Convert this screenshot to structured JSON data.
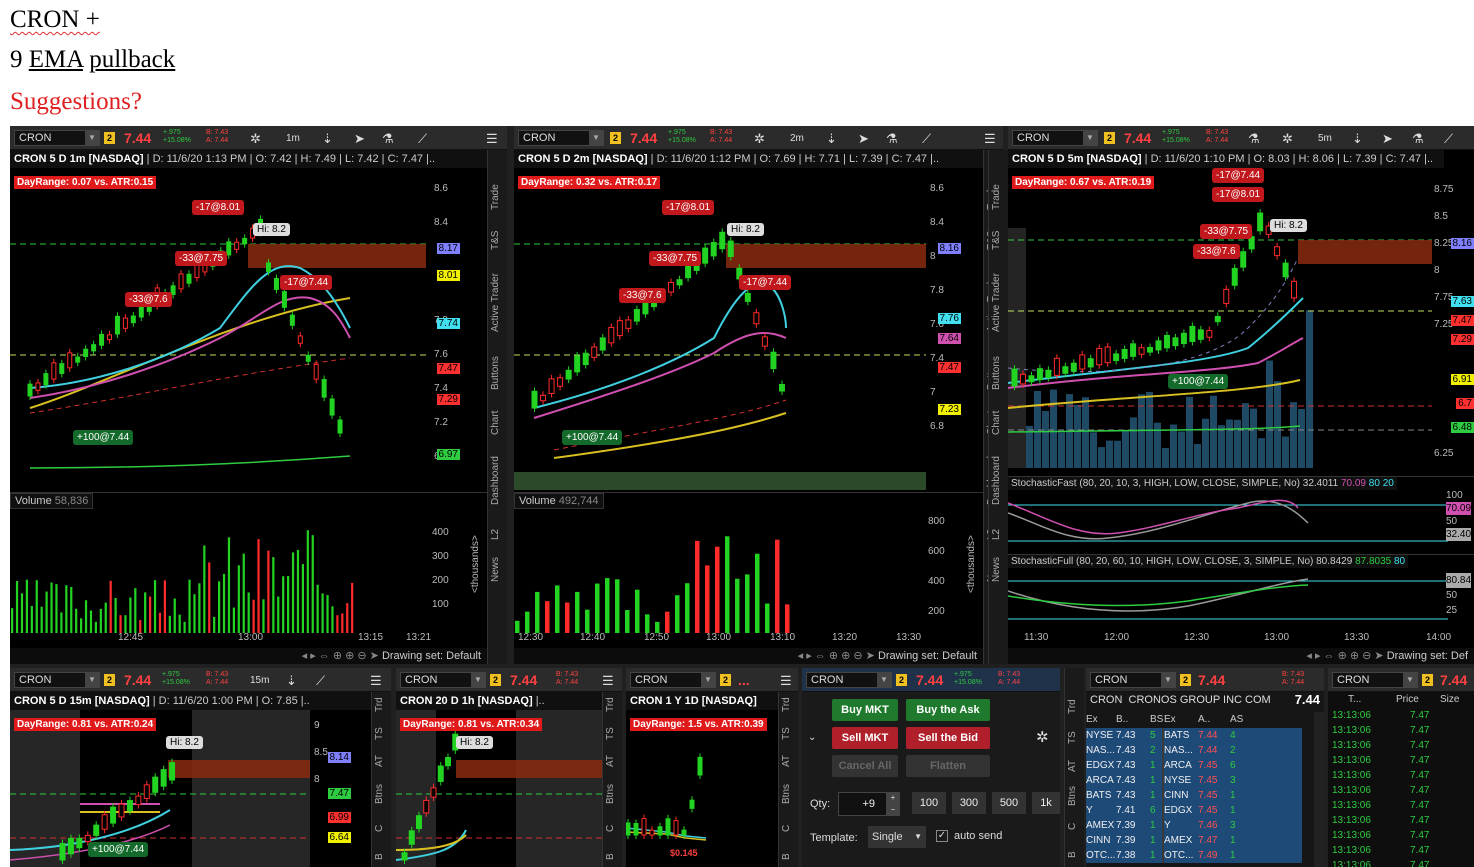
{
  "doc": {
    "line1": "CRON +",
    "line2_num": "9",
    "line2_ema": "EMA",
    "line2_rest": "pullback",
    "line3": "Suggestions?"
  },
  "colors": {
    "up": "#22d322",
    "down": "#ff2a2a",
    "ema9": "#3fd0e0",
    "ema_pink": "#d050b0",
    "ema_yellow": "#d8c020",
    "bg": "#000000",
    "accent_red": "#e01a1a"
  },
  "panels": {
    "p1": {
      "symbol": "CRON",
      "badge": "2",
      "last": "7.44",
      "chg1": "+.975",
      "chg2": "+15.08%",
      "bid": "B: 7.43",
      "ask": "A: 7.44",
      "tf": "1m",
      "header": {
        "title": "CRON 5 D 1m [NASDAQ]",
        "rest": "D: 11/6/20 1:13 PM | O: 7.42 | H: 7.49 | L: 7.42 | C: 7.47 |.."
      },
      "dayrange": "DayRange: 0.07 vs. ATR:0.15",
      "tags": [
        "-17@8.01",
        "-33@7.75",
        "-17@7.44",
        "-33@7.6"
      ],
      "buytag": "+100@7.44",
      "hi": "Hi: 8.2",
      "yaxis": [
        "8.6",
        "8.4",
        "7.8",
        "7.6",
        "7.4",
        "7.2",
        "6.8"
      ],
      "plabels": [
        {
          "t": "8.17",
          "c": "#8080ff"
        },
        {
          "t": "8.01",
          "c": "#f0f000"
        },
        {
          "t": "7.74",
          "c": "#40e0f0"
        },
        {
          "t": "7.47",
          "c": "#ff3030"
        },
        {
          "t": "7.29",
          "c": "#ff3030"
        },
        {
          "t": "6.97",
          "c": "#2ecc40"
        }
      ],
      "volume_label": "Volume",
      "volume_value": "58,836",
      "vol_axis": [
        "400",
        "300",
        "200",
        "100"
      ],
      "vol_units": "<thousands>",
      "xaxis": [
        "12:45",
        "13:00",
        "13:15",
        "13:21"
      ],
      "footer": "Drawing set: Default"
    },
    "p2": {
      "symbol": "CRON",
      "badge": "2",
      "last": "7.44",
      "chg1": "+.975",
      "chg2": "+15.08%",
      "bid": "B: 7.43",
      "ask": "A: 7.44",
      "tf": "2m",
      "header": {
        "title": "CRON 5 D 2m [NASDAQ]",
        "rest": "D: 11/6/20 1:12 PM | O: 7.69 | H: 7.71 | L: 7.39 | C: 7.47 |.."
      },
      "dayrange": "DayRange: 0.32 vs. ATR:0.17",
      "tags": [
        "-17@8.01",
        "-33@7.75",
        "-17@7.44",
        "-33@7.6"
      ],
      "buytag": "+100@7.44",
      "hi": "Hi: 8.2",
      "yaxis": [
        "8.6",
        "8.4",
        "8",
        "7.8",
        "7.6",
        "7.4",
        "7",
        "6.8"
      ],
      "plabels": [
        {
          "t": "8.16",
          "c": "#8080ff"
        },
        {
          "t": "7.76",
          "c": "#40e0f0"
        },
        {
          "t": "7.64",
          "c": "#d050b0"
        },
        {
          "t": "7.47",
          "c": "#ff3030"
        },
        {
          "t": "7.23",
          "c": "#f0f000"
        }
      ],
      "volume_label": "Volume",
      "volume_value": "492,744",
      "vol_axis": [
        "800",
        "600",
        "400",
        "200"
      ],
      "vol_units": "<thousands>",
      "xaxis": [
        "12:30",
        "12:40",
        "12:50",
        "13:00",
        "13:10",
        "13:20",
        "13:30"
      ],
      "footer": "Drawing set: Default"
    },
    "p3": {
      "symbol": "CRON",
      "badge": "2",
      "last": "7.44",
      "chg1": "+.975",
      "chg2": "+15.08%",
      "bid": "B: 7.43",
      "ask": "A: 7.44",
      "tf": "5m",
      "header": {
        "title": "CRON 5 D 5m [NASDAQ]",
        "rest": "D: 11/6/20 1:10 PM | O: 8.03 | H: 8.06 | L: 7.39 | C: 7.47 |.."
      },
      "dayrange": "DayRange: 0.67 vs. ATR:0.19",
      "tags": [
        "-17@7.44",
        "-17@8.01",
        "-33@7.75",
        "-33@7.6"
      ],
      "buytag": "+100@7.44",
      "hi": "Hi: 8.2",
      "yaxis": [
        "8.75",
        "8.5",
        "8.25",
        "8",
        "7.75",
        "7.25",
        "6.25"
      ],
      "plabels": [
        {
          "t": "8.16",
          "c": "#8080ff"
        },
        {
          "t": "7.63",
          "c": "#40e0f0"
        },
        {
          "t": "7.47",
          "c": "#ff3030"
        },
        {
          "t": "7.29",
          "c": "#ff3030"
        },
        {
          "t": "6.91",
          "c": "#f0f000"
        },
        {
          "t": "6.7",
          "c": "#ff3030"
        },
        {
          "t": "6.48",
          "c": "#2ecc40"
        }
      ],
      "stoch1": {
        "label": "StochasticFast (80, 20, 10, 3, HIGH, LOW, CLOSE, SIMPLE, No)",
        "v1": "32.4011",
        "v2": "70.09",
        "v3": "80",
        "v4": "20",
        "axis": [
          "100",
          "70.09",
          "50",
          "32.40"
        ]
      },
      "stoch2": {
        "label": "StochasticFull (80, 20, 60, 10, HIGH, LOW, CLOSE, 3, SIMPLE, No)",
        "v1": "80.8429",
        "v2": "87.8035",
        "v3": "80",
        "axis": [
          "80.84",
          "50",
          "25"
        ]
      },
      "xaxis": [
        "11:30",
        "12:00",
        "12:30",
        "13:00",
        "13:30",
        "14:00"
      ],
      "footer": "Drawing set: Def"
    },
    "p4": {
      "symbol": "CRON",
      "badge": "2",
      "last": "7.44",
      "chg1": "+.975",
      "chg2": "+15.08%",
      "bid": "B: 7.43",
      "ask": "A: 7.44",
      "tf": "15m",
      "header": {
        "title": "CRON 5 D 15m [NASDAQ]",
        "rest": "D: 11/6/20 1:00 PM | O: 7.85 |.."
      },
      "dayrange": "DayRange: 0.81 vs. ATR:0.24",
      "hi": "Hi: 8.2",
      "buytag": "+100@7.44",
      "yaxis": [
        "9",
        "8.5",
        "8"
      ],
      "plabels": [
        {
          "t": "8.14",
          "c": "#8080ff"
        },
        {
          "t": "7.47",
          "c": "#2ecc40"
        },
        {
          "t": "6.99",
          "c": "#ff3030"
        },
        {
          "t": "6.64",
          "c": "#f0f000"
        }
      ]
    },
    "p5": {
      "symbol": "CRON",
      "badge": "2",
      "last": "7.44",
      "bid": "B: 7.43",
      "ask": "A: 7.44",
      "header": {
        "title": "CRON 20 D 1h [NASDAQ]",
        "rest": "|.."
      },
      "dayrange": "DayRange: 0.81 vs. ATR:0.34",
      "hi": "Hi: 8.2"
    },
    "p6": {
      "symbol": "CRON",
      "badge": "2",
      "more": "...",
      "header": {
        "title": "CRON 1 Y 1D [NASDAQ]"
      },
      "dayrange": "DayRange: 1.5 vs. ATR:0.39",
      "low": "$0.145"
    },
    "trade": {
      "symbol": "CRON",
      "badge": "2",
      "last": "7.44",
      "chg1": "+.975",
      "chg2": "+15.08%",
      "bid": "B: 7.43",
      "ask": "A: 7.44",
      "buy_mkt": "Buy MKT",
      "buy_ask": "Buy the Ask",
      "sell_mkt": "Sell MKT",
      "sell_bid": "Sell the Bid",
      "cancel_all": "Cancel All",
      "flatten": "Flatten",
      "qty_label": "Qty:",
      "qty_value": "+9",
      "qtys": [
        "100",
        "300",
        "500",
        "1k"
      ],
      "template_label": "Template:",
      "template_value": "Single",
      "autosend": "auto send"
    },
    "level2": {
      "symbol": "CRON",
      "badge": "2",
      "last": "7.44",
      "bid": "B: 7.43",
      "ask": "A: 7.44",
      "name_sym": "CRON",
      "name": "CRONOS GROUP INC COM",
      "name_price": "7.44",
      "headers": [
        "Ex",
        "B..",
        "BS",
        "Ex",
        "A..",
        "AS"
      ],
      "rows": [
        [
          "NYSE",
          "7.43",
          "5",
          "BATS",
          "7.44",
          "4"
        ],
        [
          "NAS...",
          "7.43",
          "2",
          "NAS...",
          "7.44",
          "2"
        ],
        [
          "EDGX",
          "7.43",
          "1",
          "ARCA",
          "7.45",
          "6"
        ],
        [
          "ARCA",
          "7.43",
          "1",
          "NYSE",
          "7.45",
          "3"
        ],
        [
          "BATS",
          "7.43",
          "1",
          "CINN",
          "7.45",
          "1"
        ],
        [
          "Y",
          "7.41",
          "6",
          "EDGX",
          "7.45",
          "1"
        ],
        [
          "AMEX",
          "7.39",
          "1",
          "Y",
          "7.46",
          "3"
        ],
        [
          "CINN",
          "7.39",
          "1",
          "AMEX",
          "7.47",
          "1"
        ],
        [
          "OTC...",
          "7.38",
          "1",
          "OTC...",
          "7.49",
          "1"
        ]
      ]
    },
    "ts": {
      "symbol": "CRON",
      "badge": "2",
      "last": "7.44",
      "headers": [
        "T...",
        "Price",
        "Size"
      ],
      "rows": [
        [
          "13:13:06",
          "7.47"
        ],
        [
          "13:13:06",
          "7.47"
        ],
        [
          "13:13:06",
          "7.47"
        ],
        [
          "13:13:06",
          "7.47"
        ],
        [
          "13:13:06",
          "7.47"
        ],
        [
          "13:13:06",
          "7.47"
        ],
        [
          "13:13:06",
          "7.47"
        ],
        [
          "13:13:06",
          "7.47"
        ],
        [
          "13:13:06",
          "7.47"
        ],
        [
          "13:13:06",
          "7.47"
        ],
        [
          "13:13:06",
          "7.47"
        ],
        [
          "13:13:06",
          "7.47"
        ],
        [
          "13:13:06",
          "7.47"
        ]
      ]
    },
    "sidetabs": [
      "Trade",
      "T&S",
      "Active Trader",
      "Buttons",
      "Chart",
      "Dashboard",
      "L2",
      "News"
    ],
    "sidetabs_small": [
      "Trd",
      "TS",
      "AT",
      "Btns",
      "C",
      "B"
    ]
  }
}
